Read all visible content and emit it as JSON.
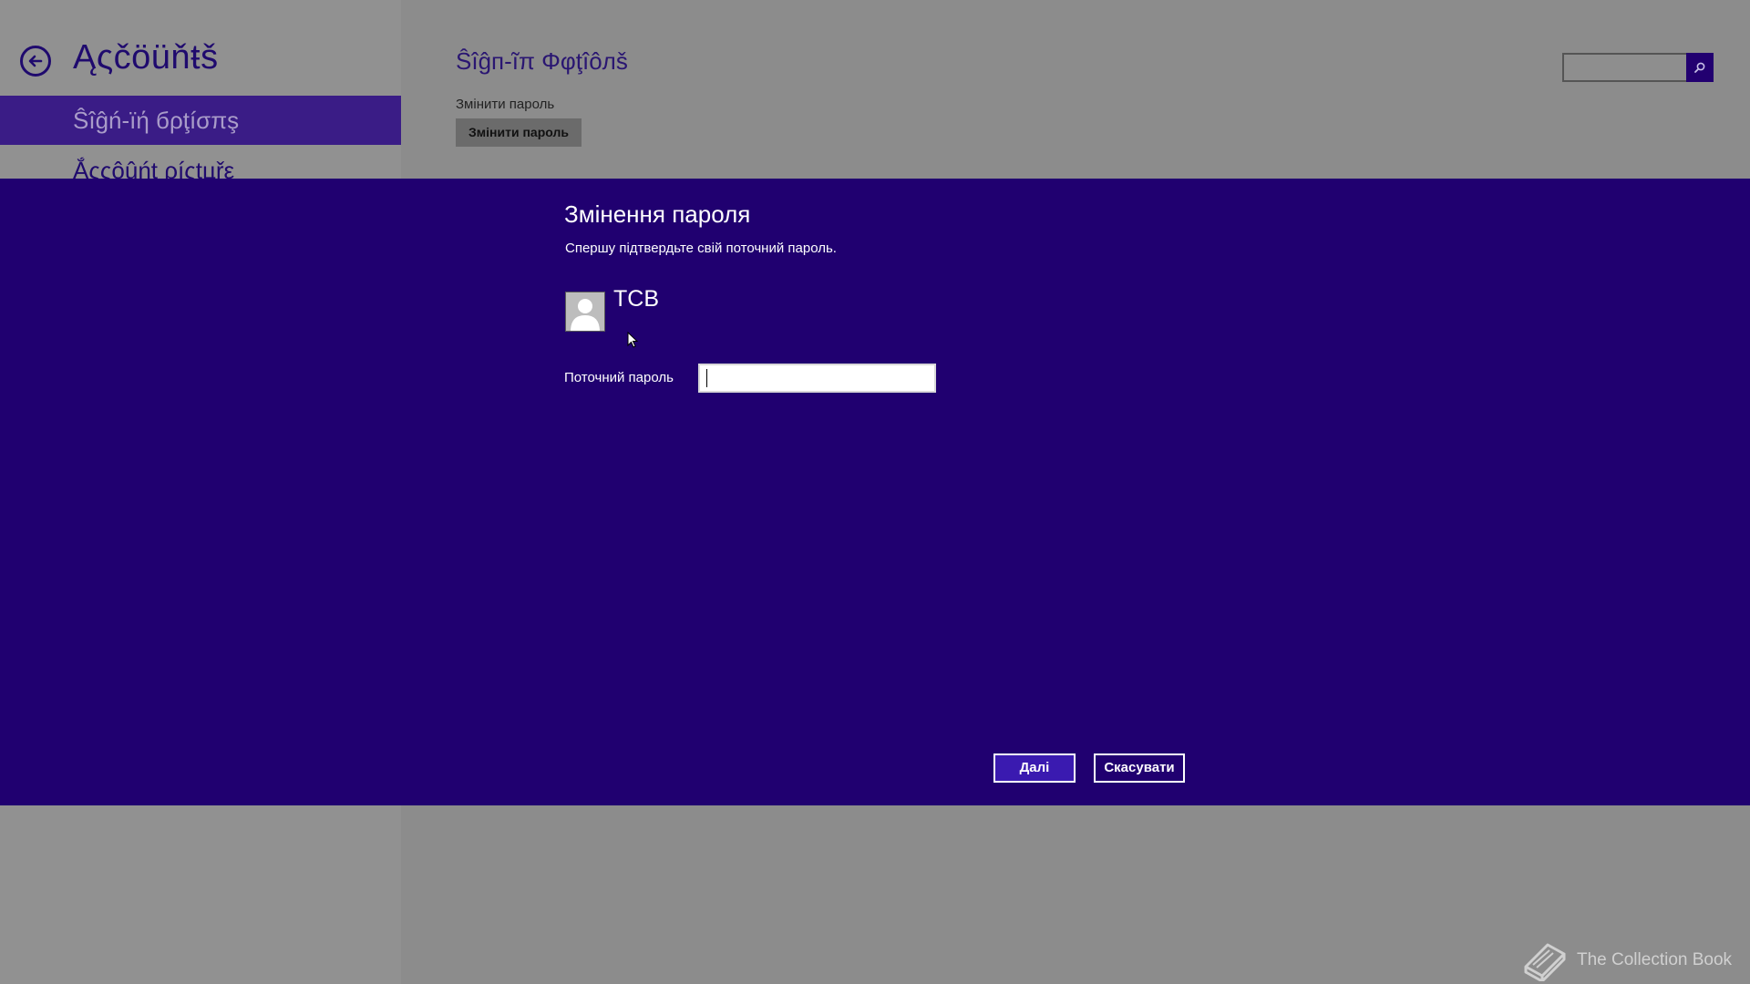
{
  "app": {
    "title": "Ąςčöüňŧš",
    "back_icon": "back-arrow-icon"
  },
  "nav": {
    "items": [
      {
        "label": "Ŝîĝń-ïή бρţíσπş",
        "selected": true
      },
      {
        "label": "Ắςςôûńţ ρíςţцřε",
        "selected": false
      }
    ]
  },
  "background_page": {
    "section_title": "Ŝîĝп-ĩπ Φφţîôлš",
    "change_password_label": "Змінити пароль",
    "change_password_button": "Змінити пароль",
    "search_icon": "search-icon"
  },
  "dialog": {
    "title": "Змінення пароля",
    "subtitle": "Спершу підтвердьте свій поточний пароль.",
    "user_name": "TCB",
    "avatar_icon": "user-avatar-icon",
    "current_password_label": "Поточний пароль",
    "current_password_value": "",
    "next_button": "Далі",
    "cancel_button": "Скасувати"
  },
  "watermark": {
    "text": "The Collection Book",
    "icon": "book-icon"
  },
  "colors": {
    "accent": "#200070",
    "selected_nav": "#3a1c86",
    "dim_background": "#8c8c8c",
    "next_button": "#3a1ab0"
  }
}
